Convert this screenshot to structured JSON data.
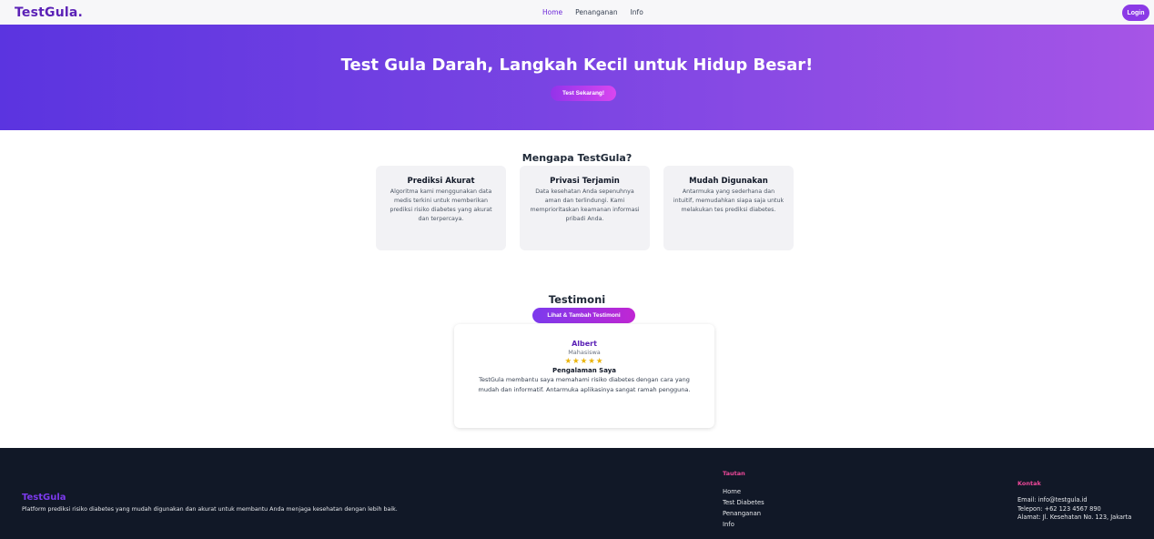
{
  "nav": {
    "brand": "TestGula.",
    "links": [
      "Home",
      "Penanganan",
      "Info"
    ],
    "login": "Login"
  },
  "hero": {
    "title": "Test Gula Darah, Langkah Kecil untuk Hidup Besar!",
    "cta": "Test Sekarang!"
  },
  "why": {
    "title": "Mengapa TestGula?",
    "cards": [
      {
        "title": "Prediksi Akurat",
        "desc": "Algoritma kami menggunakan data medis terkini untuk memberikan prediksi risiko diabetes yang akurat dan terpercaya."
      },
      {
        "title": "Privasi Terjamin",
        "desc": "Data kesehatan Anda sepenuhnya aman dan terlindungi. Kami memprioritaskan keamanan informasi pribadi Anda."
      },
      {
        "title": "Mudah Digunakan",
        "desc": "Antarmuka yang sederhana dan intuitif, memudahkan siapa saja untuk melakukan tes prediksi diabetes."
      }
    ]
  },
  "testimonials": {
    "title": "Testimoni",
    "button": "Lihat & Tambah Testimoni",
    "item": {
      "name": "Albert",
      "role": "Mahasiswa",
      "rating": 5,
      "stars": "★★★★★",
      "heading": "Pengalaman Saya",
      "text": "TestGula membantu saya memahami risiko diabetes dengan cara yang mudah dan informatif. Antarmuka aplikasinya sangat ramah pengguna."
    }
  },
  "footer": {
    "brand": "TestGula",
    "description": "Platform prediksi risiko diabetes yang mudah digunakan dan akurat untuk membantu Anda menjaga kesehatan dengan lebih baik.",
    "links_title": "Tautan",
    "links": [
      "Home",
      "Test Diabetes",
      "Penanganan",
      "Info"
    ],
    "contact_title": "Kontak",
    "email": "Email: info@testgula.id",
    "phone": "Telepon: +62 123 4567 890",
    "address": "Alamat: Jl. Kesehatan No. 123, Jakarta"
  },
  "colors": {
    "brand": "#5b21b6",
    "hero_start": "#5b34e0",
    "hero_end": "#a655e6",
    "footer_bg": "#111827",
    "footer_heading": "#ec4899",
    "star": "#eab308"
  }
}
